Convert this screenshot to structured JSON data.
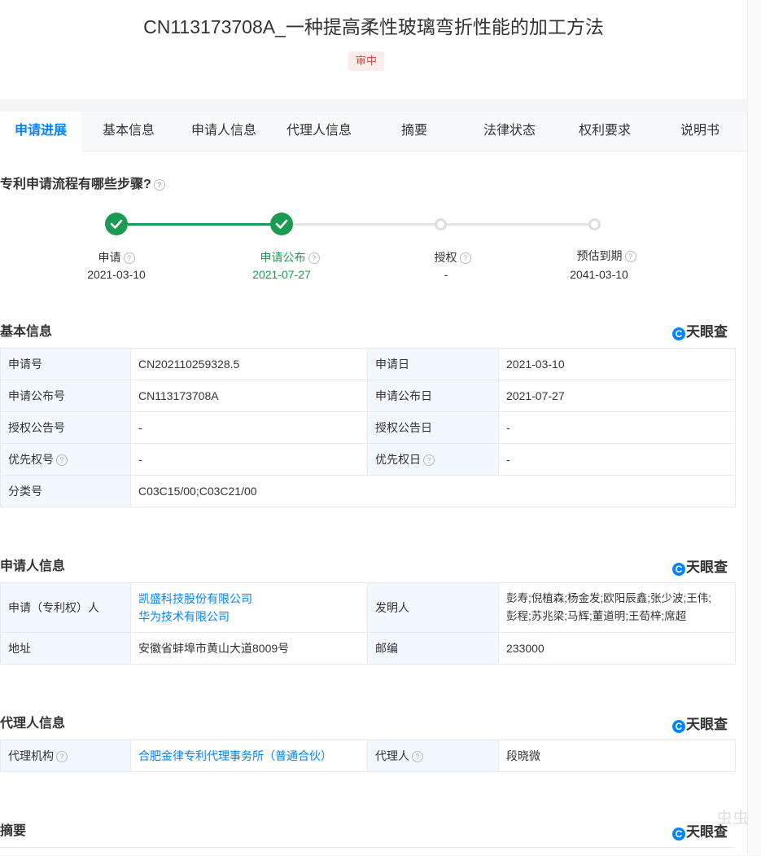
{
  "header": {
    "title": "CN113173708A_一种提高柔性玻璃弯折性能的加工方法",
    "status": "审中"
  },
  "tabs": [
    "申请进展",
    "基本信息",
    "申请人信息",
    "代理人信息",
    "摘要",
    "法律状态",
    "权利要求",
    "说明书"
  ],
  "progress": {
    "question": "专利申请流程有哪些步骤?",
    "steps": [
      {
        "label": "申请",
        "date": "2021-03-10"
      },
      {
        "label": "申请公布",
        "date": "2021-07-27"
      },
      {
        "label": "授权",
        "date": "-"
      },
      {
        "label": "预估到期",
        "date": "2041-03-10"
      }
    ]
  },
  "logo_text": "天眼查",
  "basic": {
    "heading": "基本信息",
    "rows": [
      {
        "k1": "申请号",
        "v1": "CN202110259328.5",
        "k2": "申请日",
        "v2": "2021-03-10"
      },
      {
        "k1": "申请公布号",
        "v1": "CN113173708A",
        "k2": "申请公布日",
        "v2": "2021-07-27"
      },
      {
        "k1": "授权公告号",
        "v1": "-",
        "k2": "授权公告日",
        "v2": "-"
      },
      {
        "k1": "优先权号",
        "v1": "-",
        "k2": "优先权日",
        "v2": "-"
      }
    ],
    "class_label": "分类号",
    "class_value": "C03C15/00;C03C21/00"
  },
  "applicant": {
    "heading": "申请人信息",
    "applicant_label": "申请（专利权）人",
    "applicants": [
      "凯盛科技股份有限公司",
      "华为技术有限公司"
    ],
    "inventor_label": "发明人",
    "inventors_line1": "彭寿;倪植森;杨金发;欧阳辰鑫;张少波;王伟;",
    "inventors_line2": "彭程;苏兆梁;马辉;董道明;王荀梓;席超",
    "address_label": "地址",
    "address": "安徽省蚌埠市黄山大道8009号",
    "zip_label": "邮编",
    "zip": "233000"
  },
  "agent": {
    "heading": "代理人信息",
    "org_label": "代理机构",
    "org": "合肥金律专利代理事务所（普通合伙）",
    "person_label": "代理人",
    "person": "段晓微"
  },
  "abstract": {
    "heading": "摘要"
  },
  "watermark": "虫虫",
  "colors": {
    "accent": "#0084ff",
    "done": "#1a9b52",
    "status": "#e0463c"
  }
}
